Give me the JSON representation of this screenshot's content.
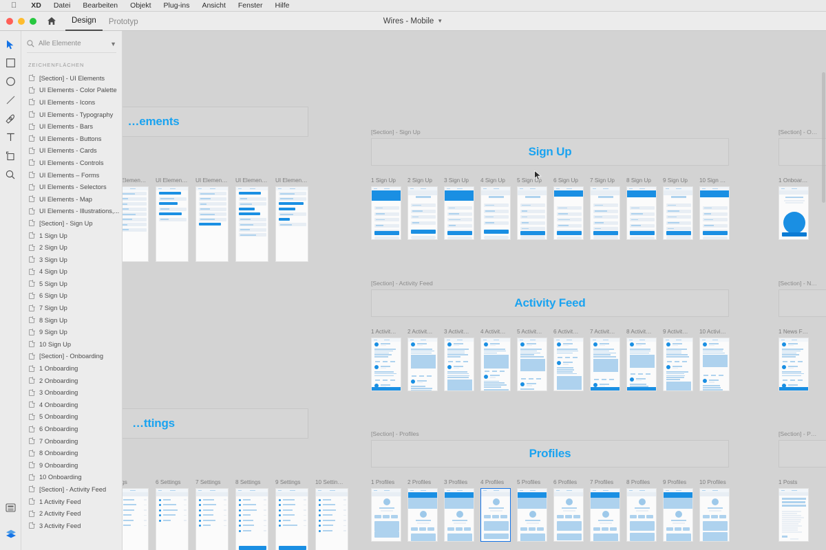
{
  "menubar": {
    "apple_icon": "apple-icon",
    "items": [
      {
        "label": "XD",
        "strong": true
      },
      {
        "label": "Datei",
        "strong": false
      },
      {
        "label": "Bearbeiten",
        "strong": false
      },
      {
        "label": "Objekt",
        "strong": false
      },
      {
        "label": "Plug-ins",
        "strong": false
      },
      {
        "label": "Ansicht",
        "strong": false
      },
      {
        "label": "Fenster",
        "strong": false
      },
      {
        "label": "Hilfe",
        "strong": false
      }
    ]
  },
  "titlebar": {
    "home_icon": "home-icon",
    "tabs": [
      {
        "label": "Design",
        "active": true
      },
      {
        "label": "Prototyp",
        "active": false
      }
    ],
    "document_title": "Wires - Mobile",
    "document_chevron": "chevron-down-icon"
  },
  "toolrail": {
    "tools": [
      {
        "name": "select-tool",
        "active": true
      },
      {
        "name": "rectangle-tool",
        "active": false
      },
      {
        "name": "ellipse-tool",
        "active": false
      },
      {
        "name": "line-tool",
        "active": false
      },
      {
        "name": "pen-tool",
        "active": false
      },
      {
        "name": "text-tool",
        "active": false
      },
      {
        "name": "artboard-tool",
        "active": false
      },
      {
        "name": "zoom-tool",
        "active": false
      }
    ],
    "bottom": [
      {
        "name": "assets-panel-icon"
      },
      {
        "name": "libraries-icon"
      }
    ]
  },
  "panel": {
    "search_placeholder": "Alle Elemente",
    "search_icon": "search-icon",
    "filter_chevron": "chevron-down-icon",
    "section_heading": "ZEICHENFLÄCHEN",
    "layers": [
      "[Section] - UI Elements",
      "UI Elements - Color Palette",
      "UI Elements - Icons",
      "UI Elements - Typography",
      "UI Elements - Bars",
      "UI Elements - Buttons",
      "UI Elements - Cards",
      "UI Elements - Controls",
      "UI Elements – Forms",
      "UI Elements - Selectors",
      "UI Elements - Map",
      "UI Elements - Illustrations,...",
      "[Section] - Sign Up",
      "1 Sign Up",
      "2 Sign Up",
      "3 Sign Up",
      "4 Sign Up",
      "5 Sign Up",
      "6 Sign Up",
      "7 Sign Up",
      "8 Sign Up",
      "9 Sign Up",
      "10 Sign Up",
      "[Section] - Onboarding",
      "1 Onboarding",
      "2 Onboarding",
      "3 Onboarding",
      "4 Onboarding",
      "5 Onboarding",
      "6 Onboarding",
      "7 Onboarding",
      "8 Onboarding",
      "9 Onboarding",
      "10 Onboarding",
      "[Section] - Activity Feed",
      "1 Activity Feed",
      "2 Activity Feed",
      "3 Activity Feed"
    ]
  },
  "canvas": {
    "accent_color": "#1aa3f0",
    "selection_color": "#1473e6",
    "background_color": "#d3d3d3",
    "sections": [
      {
        "id": "ui-elements",
        "label": "",
        "title": "…ements",
        "thumb_labels": [
          "…Elemen…",
          "UI Elemen…",
          "UI Elemen…",
          "UI Elemen…",
          "UI Elemen…"
        ]
      },
      {
        "id": "sign-up",
        "label": "[Section] - Sign Up",
        "title": "Sign Up",
        "thumb_labels": [
          "1 Sign Up",
          "2 Sign Up",
          "3 Sign Up",
          "4 Sign Up",
          "5 Sign Up",
          "6 Sign Up",
          "7 Sign Up",
          "8 Sign Up",
          "9 Sign Up",
          "10 Sign …"
        ]
      },
      {
        "id": "activity-feed",
        "label": "[Section] - Activity Feed",
        "title": "Activity Feed",
        "thumb_labels": [
          "1 Activit…",
          "2 Activit…",
          "3 Activit…",
          "4 Activit…",
          "5 Activit…",
          "6 Activit…",
          "7 Activit…",
          "8 Activit…",
          "9 Activit…",
          "10 Activi…"
        ]
      },
      {
        "id": "profiles",
        "label": "[Section] - Profiles",
        "title": "Profiles",
        "thumb_labels": [
          "1 Profiles",
          "2 Profiles",
          "3 Profiles",
          "4 Profiles",
          "5 Profiles",
          "6 Profiles",
          "7 Profiles",
          "8 Profiles",
          "9 Profiles",
          "10 Profiles"
        ]
      },
      {
        "id": "settings",
        "label": "",
        "title": "…ttings",
        "thumb_labels": [
          "…gs",
          "6 Settings",
          "7 Settings",
          "8 Settings",
          "9 Settings",
          "10 Settin…"
        ]
      }
    ],
    "right_sections": [
      {
        "label": "[Section] - O…",
        "thumb_label": "1 Onboar…"
      },
      {
        "label": "[Section] - N…",
        "thumb_label": "1 News F…"
      },
      {
        "label": "[Section] - P…",
        "thumb_label": "1 Posts"
      }
    ]
  }
}
